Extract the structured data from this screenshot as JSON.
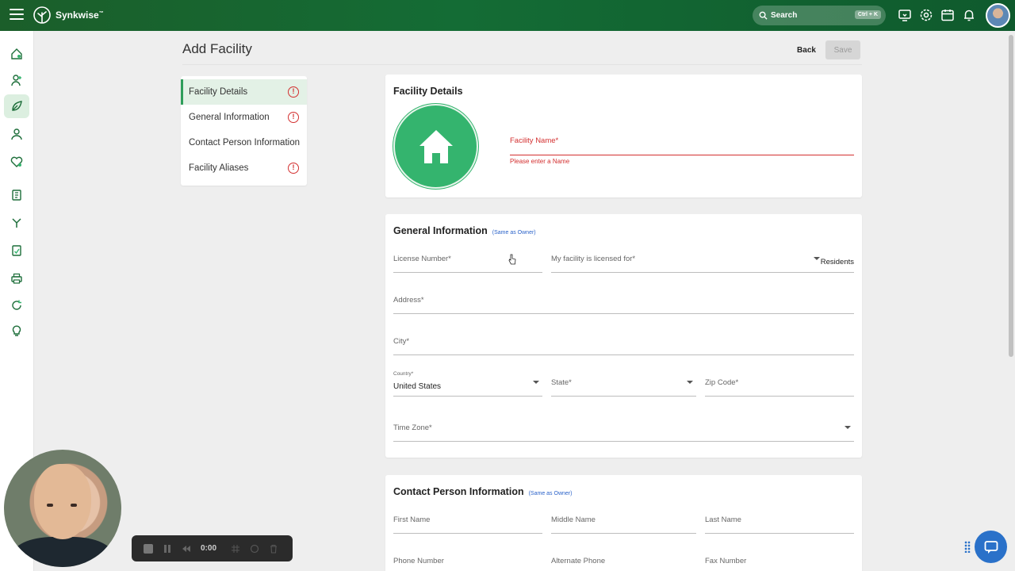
{
  "app": {
    "name": "Synkwise",
    "trademark": "™"
  },
  "search": {
    "label": "Search",
    "shortcut": "Ctrl + K"
  },
  "topbar_icons": [
    "tablet-icon",
    "settings-gear-icon",
    "calendar-icon",
    "bell-icon",
    "user-avatar"
  ],
  "sidebar_icons": [
    "home-icon",
    "add-user-icon",
    "facility-leaf-icon",
    "resident-icon",
    "care-icon",
    "document-icon",
    "branch-icon",
    "report-icon",
    "printer-icon",
    "refresh-icon",
    "bulb-icon"
  ],
  "page": {
    "title": "Add Facility",
    "back_label": "Back",
    "save_label": "Save"
  },
  "section_nav": [
    {
      "label": "Facility Details",
      "warning": "!"
    },
    {
      "label": "General Information",
      "warning": "!"
    },
    {
      "label": "Contact Person Information",
      "warning": ""
    },
    {
      "label": "Facility Aliases",
      "warning": "!"
    }
  ],
  "facility_details": {
    "title": "Facility Details",
    "name_label": "Facility Name*",
    "name_error": "Please enter a Name"
  },
  "general_information": {
    "title": "General Information",
    "same_as_owner": "(Same as Owner)",
    "license_label": "License Number*",
    "licensed_for_label": "My facility is licensed for*",
    "licensed_for_suffix": "Residents",
    "address_label": "Address*",
    "city_label": "City*",
    "country_label": "Country*",
    "country_value": "United States",
    "state_label": "State*",
    "zip_label": "Zip Code*",
    "timezone_label": "Time Zone*"
  },
  "contact_person": {
    "title": "Contact Person Information",
    "same_as_owner": "(Same as Owner)",
    "first_name_label": "First Name",
    "middle_name_label": "Middle Name",
    "last_name_label": "Last Name",
    "phone_label": "Phone Number",
    "alt_phone_label": "Alternate Phone",
    "fax_label": "Fax Number"
  },
  "recorder": {
    "time": "0:00"
  },
  "colors": {
    "brand": "#146c35",
    "accent": "#34b46e",
    "error": "#d32f2f",
    "link": "#2a62c9"
  }
}
